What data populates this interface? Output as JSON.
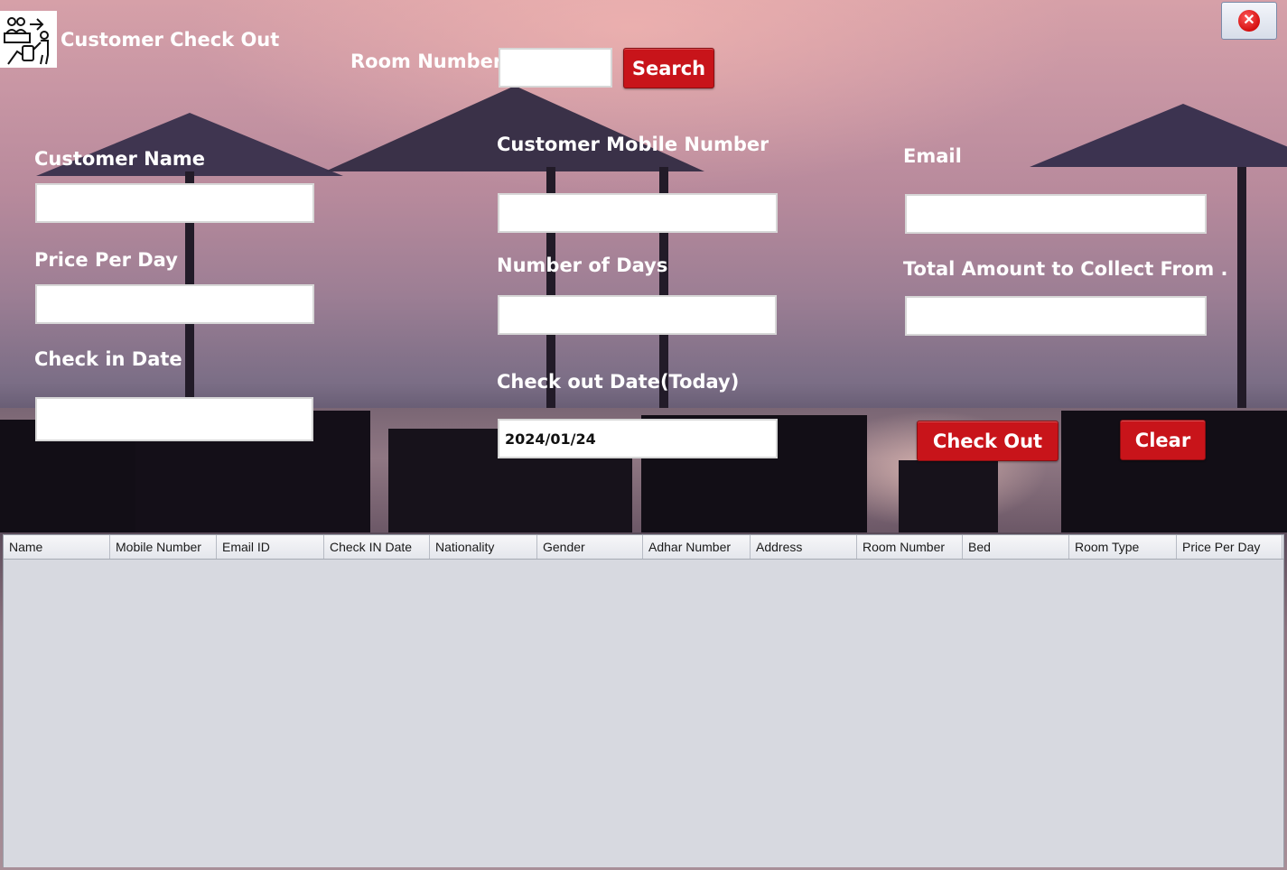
{
  "window": {
    "title": "Customer Check Out",
    "app_icon": "reception-checkout-icon",
    "close_icon": "close-icon"
  },
  "search": {
    "room_number_label": "Room Number",
    "room_number_value": "",
    "search_button": "Search"
  },
  "form": {
    "customer_name_label": "Customer Name",
    "customer_name_value": "",
    "mobile_label": "Customer Mobile Number",
    "mobile_value": "",
    "email_label": "Email",
    "email_value": "",
    "price_label": "Price Per Day",
    "price_value": "",
    "days_label": "Number of Days",
    "days_value": "",
    "total_label": "Total Amount to Collect From ...",
    "total_value": "",
    "checkin_label": "Check in Date",
    "checkin_value": "",
    "checkout_label": "Check out Date(Today)",
    "checkout_value": "2024/01/24"
  },
  "actions": {
    "checkout_button": "Check Out",
    "clear_button": "Clear"
  },
  "table": {
    "columns": [
      "Name",
      "Mobile Number",
      "Email ID",
      "Check IN Date",
      "Nationality",
      "Gender",
      "Adhar Number",
      "Address",
      "Room Number",
      "Bed",
      "Room Type",
      "Price Per Day"
    ],
    "rows": []
  },
  "colors": {
    "button_red": "#c8141a",
    "label_text": "#ffffff",
    "table_background": "#d7d9e0"
  }
}
